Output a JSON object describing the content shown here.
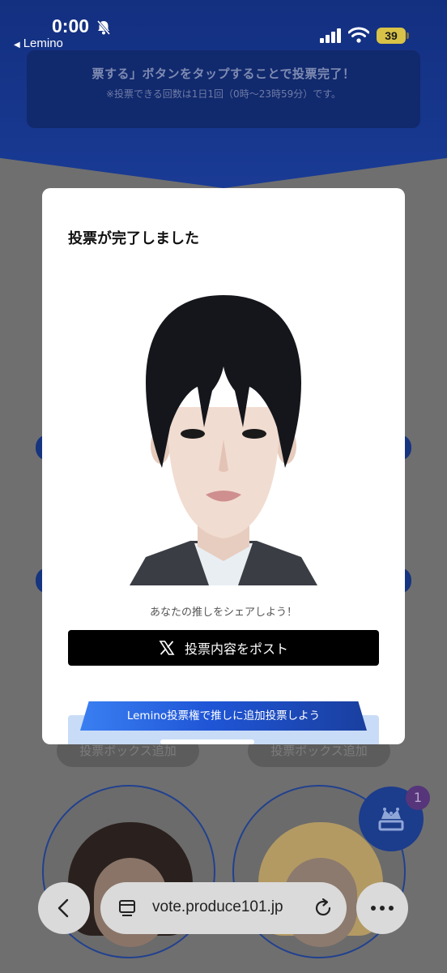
{
  "status_bar": {
    "time": "0:00",
    "back_app": "Lemino",
    "battery": "39"
  },
  "background": {
    "notice_line1": "票する」ボタンをタップすることで投票完了！",
    "notice_line2": "※投票できる回数は1日1回（0時〜23時59分）です。",
    "add_vote_box_left": "投票ボックス追加",
    "add_vote_box_right": "投票ボックス追加",
    "fab_badge": "1",
    "colors": {
      "header": "#132f80",
      "fab": "#1c3c8c"
    }
  },
  "modal": {
    "title": "投票が完了しました",
    "share_caption": "あなたの推しをシェアしよう！",
    "post_button_label": "投票内容をポスト",
    "promo_banner": "Lemino投票権で推しに追加投票しよう",
    "icons": {
      "post": "x-logo-icon"
    }
  },
  "browser": {
    "url": "vote.produce101.jp",
    "icons": {
      "back": "chevron-left-icon",
      "tabs": "tab-icon",
      "reload": "reload-icon",
      "more": "more-icon"
    }
  }
}
